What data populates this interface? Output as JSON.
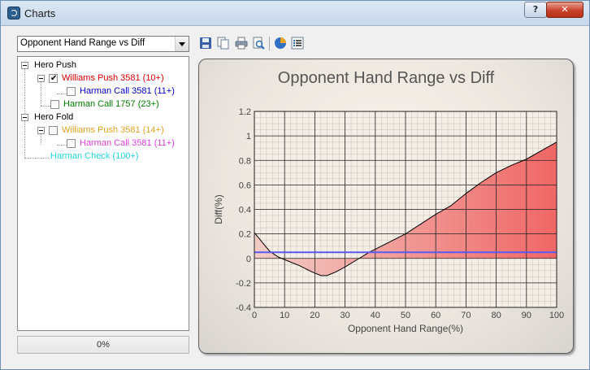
{
  "window": {
    "title": "Charts"
  },
  "titlebar": {
    "help_label": "?",
    "close_label": "✕"
  },
  "chart_selector": {
    "selected": "Opponent Hand Range vs Diff"
  },
  "toolbar": {
    "icons": [
      "save-icon",
      "copy-icon",
      "print-icon",
      "print-preview-icon",
      "pie-chart-icon",
      "list-icon"
    ]
  },
  "tree": {
    "hero_push": "Hero Push",
    "williams_push_10": "Williams Push 3581 (10+)",
    "harman_call_11": "Harman Call 3581 (11+)",
    "harman_call_23": "Harman Call 1757 (23+)",
    "hero_fold": "Hero Fold",
    "williams_push_14": "Williams Push 3581 (14+)",
    "harman_call_11b": "Harman Call 3581 (11+)",
    "harman_check_100": "Harman Check (100+)"
  },
  "tree_colors": {
    "hero_push": "#000000",
    "williams_push_10": "#e00000",
    "harman_call_11": "#0000c8",
    "harman_call_23": "#008000",
    "hero_fold": "#000000",
    "williams_push_14": "#e6a020",
    "harman_call_11b": "#e040e0",
    "harman_check_100": "#20d8e0"
  },
  "progress": {
    "label": "0%",
    "value": 0
  },
  "chart_data": {
    "type": "area",
    "title": "Opponent Hand Range vs Diff",
    "xlabel": "Opponent Hand Range(%)",
    "ylabel": "Diff(%)",
    "xlim": [
      0,
      100
    ],
    "ylim": [
      -0.4,
      1.2
    ],
    "xticks": [
      0,
      10,
      20,
      30,
      40,
      50,
      60,
      70,
      80,
      90,
      100
    ],
    "yticks": [
      -0.4,
      -0.2,
      0,
      0.2,
      0.4,
      0.6,
      0.8,
      1,
      1.2
    ],
    "tick_labels_x": [
      "0",
      "10",
      "20",
      "30",
      "40",
      "50",
      "60",
      "70",
      "80",
      "90",
      "100"
    ],
    "tick_labels_y": [
      "-0.4",
      "-0.2",
      "0",
      "0.2",
      "0.4",
      "0.6",
      "0.8",
      "1",
      "1.2"
    ],
    "grid": true,
    "series": [
      {
        "color": "#000000",
        "fill": "#f05050",
        "x": [
          0,
          2,
          5,
          8,
          11,
          15,
          19,
          22,
          24,
          27,
          30,
          34,
          38,
          42,
          46,
          50,
          55,
          60,
          65,
          70,
          75,
          80,
          85,
          90,
          95,
          100
        ],
        "y": [
          0.21,
          0.15,
          0.06,
          0.01,
          -0.02,
          -0.06,
          -0.11,
          -0.14,
          -0.14,
          -0.11,
          -0.07,
          -0.01,
          0.05,
          0.1,
          0.15,
          0.2,
          0.28,
          0.36,
          0.43,
          0.53,
          0.62,
          0.7,
          0.76,
          0.81,
          0.88,
          0.95
        ]
      },
      {
        "color": "#5a5af0",
        "x": [
          0,
          100
        ],
        "y": [
          0.05,
          0.05
        ]
      }
    ]
  }
}
